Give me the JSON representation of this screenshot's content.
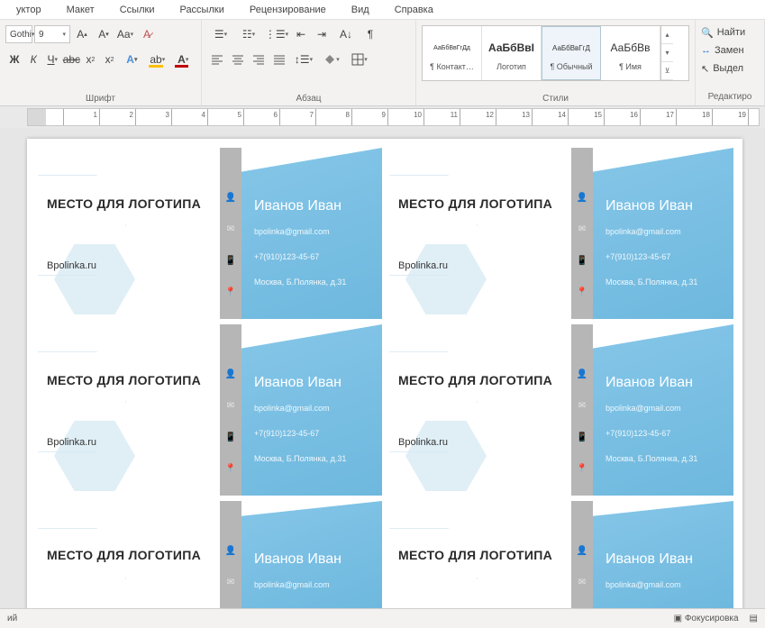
{
  "ribbon": {
    "tabs": [
      "уктор",
      "Макет",
      "Ссылки",
      "Рассылки",
      "Рецензирование",
      "Вид",
      "Справка"
    ],
    "font": {
      "name_fragment": "Gothi",
      "size": "9",
      "group_label": "Шрифт"
    },
    "paragraph": {
      "group_label": "Абзац"
    },
    "styles": {
      "group_label": "Стили",
      "items": [
        {
          "preview": "АаБбВвГгДд",
          "label": "¶ Контакт…"
        },
        {
          "preview": "АаБбВвІ",
          "label": "Логотип"
        },
        {
          "preview": "АаБбВвГгД",
          "label": "¶ Обычный"
        },
        {
          "preview": "АаБбВв",
          "label": "¶ Имя"
        }
      ]
    },
    "editing": {
      "group_label": "Редактиро",
      "find": "Найти",
      "replace": "Замен",
      "select": "Выдел"
    }
  },
  "ruler": {
    "numbers": [
      "1",
      "2",
      "3",
      "4",
      "5",
      "6",
      "7",
      "8",
      "9",
      "10",
      "11",
      "12",
      "13",
      "14",
      "15",
      "16",
      "17",
      "18",
      "19"
    ]
  },
  "card": {
    "logo_placeholder": "МЕСТО ДЛЯ ЛОГОТИПА",
    "site": "Bpolinka.ru",
    "name": "Иванов Иван",
    "email": "bpolinka@gmail.com",
    "phone": "+7(910)123-45-67",
    "address": "Москва, Б.Полянка, д.31"
  },
  "status": {
    "left_fragment": "ий",
    "focus_mode": "Фокусировка"
  }
}
